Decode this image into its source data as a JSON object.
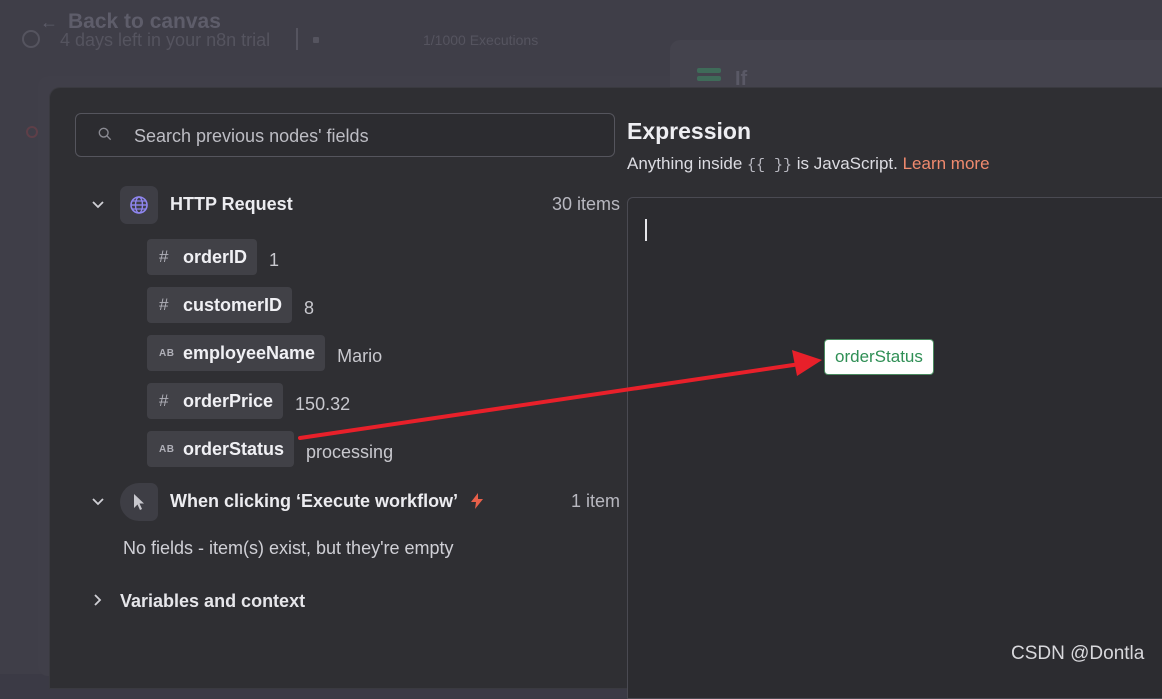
{
  "background": {
    "back_label": "Back to canvas",
    "trial_text": "4 days left in your n8n trial",
    "executions": "1/1000 Executions",
    "node_name": "If"
  },
  "search": {
    "placeholder": "Search previous nodes' fields"
  },
  "nodes": [
    {
      "title": "HTTP Request",
      "count": "30 items",
      "icon": "globe-icon",
      "fields": [
        {
          "type": "#",
          "name": "orderID",
          "value": "1"
        },
        {
          "type": "AB",
          "name": "customerID",
          "value": "8"
        },
        {
          "type": "AB",
          "name": "employeeName",
          "value": "Mario"
        },
        {
          "type": "#",
          "name": "orderPrice",
          "value": "150.32"
        },
        {
          "type": "AB",
          "name": "orderStatus",
          "value": "processing"
        }
      ]
    },
    {
      "title": "When clicking ‘Execute workflow’",
      "count": "1 item",
      "icon": "cursor-icon",
      "empty_note": "No fields - item(s) exist, but they're empty"
    }
  ],
  "variables_label": "Variables and context",
  "expression": {
    "title": "Expression",
    "subtitle_prefix": "Anything inside ",
    "subtitle_braces": "{{ }}",
    "subtitle_suffix": " is JavaScript. ",
    "learn_more": "Learn more",
    "dropped_chip": "orderStatus"
  },
  "watermark": "CSDN @Dontla",
  "colors": {
    "accent": "#f08a6e",
    "arrow": "#e8202a",
    "chip_text": "#2f8f55"
  }
}
